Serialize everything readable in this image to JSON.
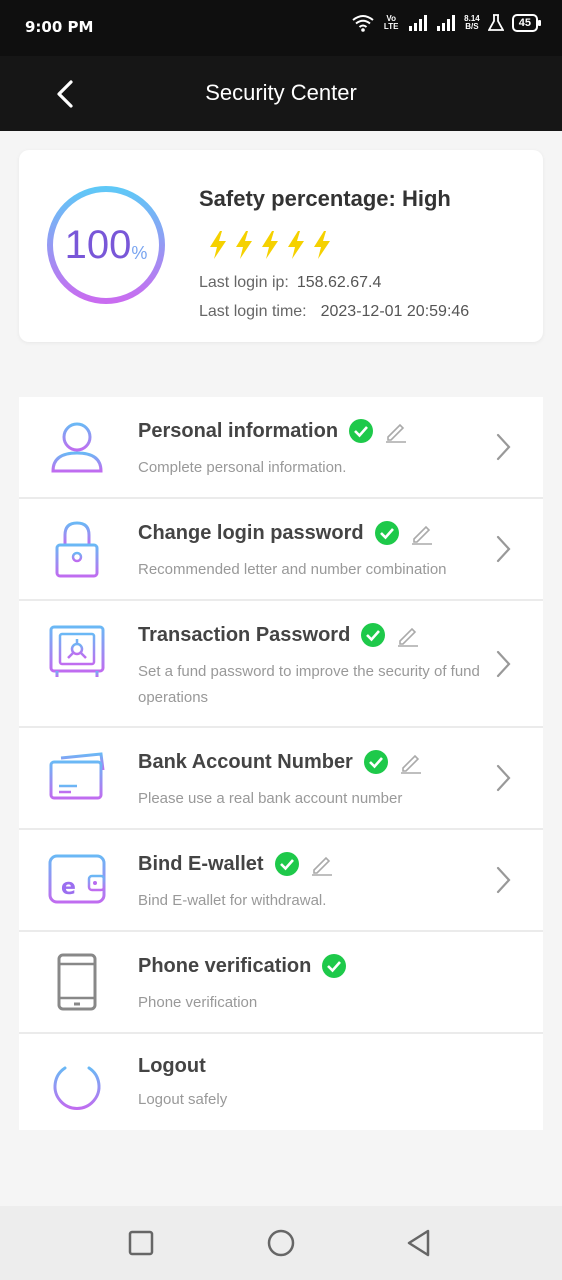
{
  "status_bar": {
    "time": "9:00 PM",
    "volte": "Vo LTE",
    "speed_top": "8.14",
    "speed_bottom": "B/S",
    "battery": "45"
  },
  "header": {
    "title": "Security Center",
    "back_icon": "chevron-left-icon"
  },
  "summary": {
    "score": "100",
    "score_unit": "%",
    "safety_label": "Safety percentage: High",
    "bolt_count": 5,
    "bolt_color": "#f5d100",
    "last_login_ip_label": "Last login ip:",
    "last_login_ip": "158.62.67.4",
    "last_login_time_label": "Last login time:",
    "last_login_time": "2023-12-01 20:59:46"
  },
  "menu": {
    "items": [
      {
        "title": "Personal information",
        "subtitle": "Complete personal information.",
        "icon": "user-icon",
        "verified": true,
        "editable": true
      },
      {
        "title": "Change login password",
        "subtitle": "Recommended letter and number combination",
        "icon": "lock-icon",
        "verified": true,
        "editable": true
      },
      {
        "title": "Transaction Password",
        "subtitle": "Set a fund password to improve the security of fund operations",
        "icon": "safe-icon",
        "verified": true,
        "editable": true
      },
      {
        "title": "Bank Account Number",
        "subtitle": "Please use a real bank account number",
        "icon": "bank-card-icon",
        "verified": true,
        "editable": true
      },
      {
        "title": "Bind E-wallet",
        "subtitle": "Bind E-wallet for withdrawal.",
        "icon": "wallet-icon",
        "verified": true,
        "editable": true
      },
      {
        "title": "Phone verification",
        "subtitle": "Phone verification",
        "icon": "phone-icon",
        "verified": true,
        "editable": false
      },
      {
        "title": "Logout",
        "subtitle": "Logout safely",
        "icon": "power-icon",
        "verified": false,
        "editable": false
      }
    ]
  },
  "colors": {
    "accent_purple": "#b86cf0",
    "accent_blue": "#6ab8f5",
    "check_green": "#1ec94a",
    "header_bg": "#161616"
  }
}
